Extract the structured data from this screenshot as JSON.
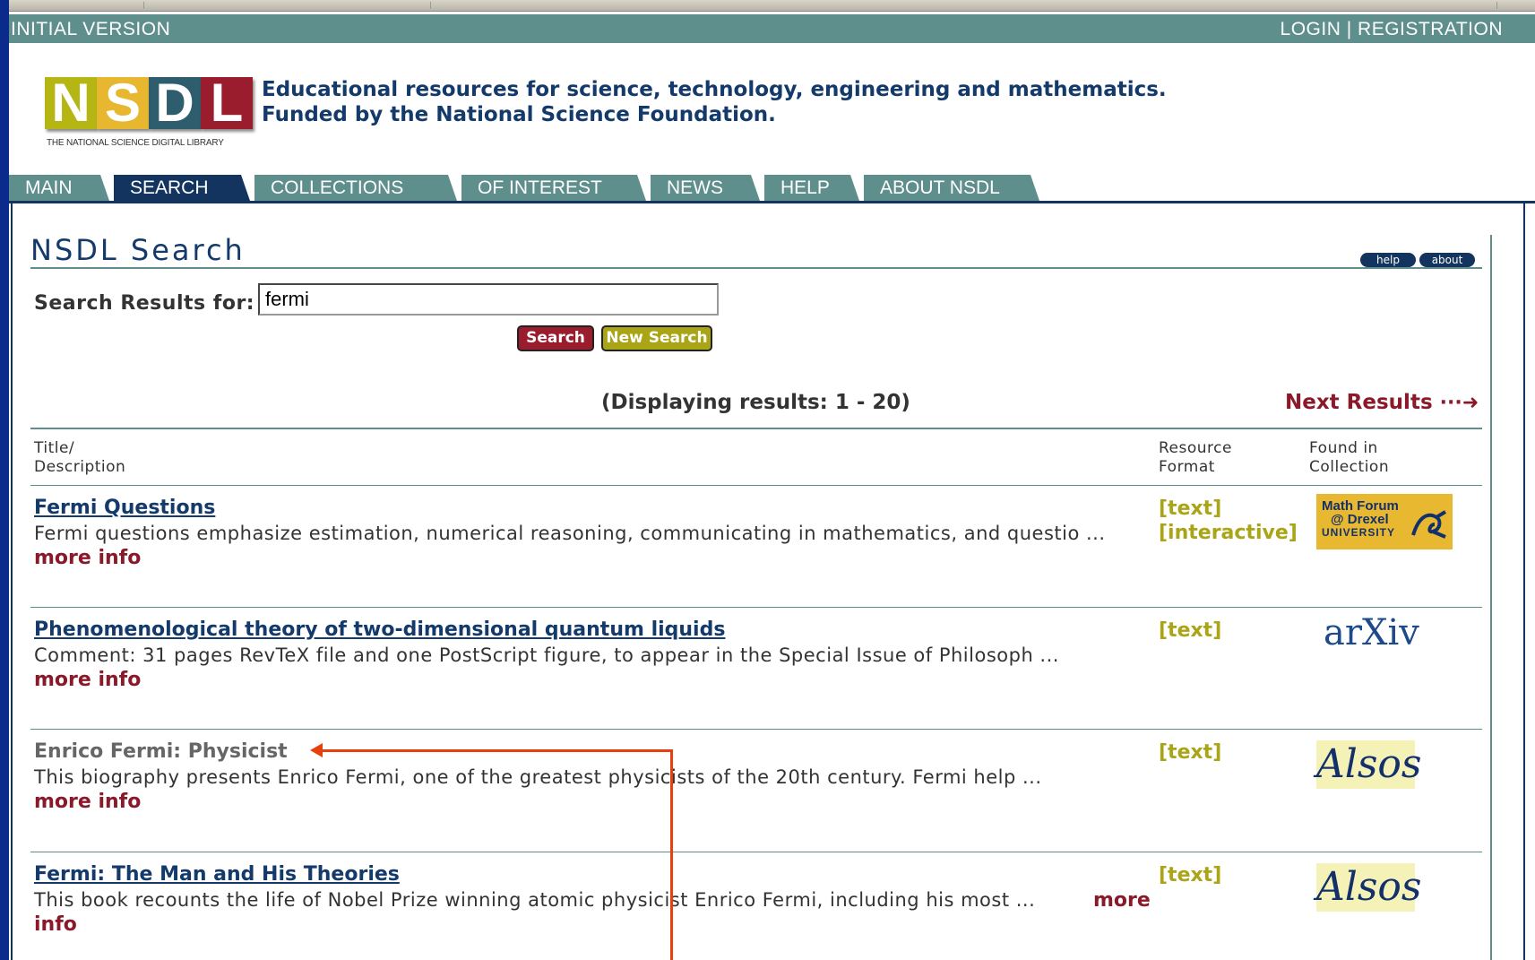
{
  "topbar": {
    "version": "INITIAL VERSION",
    "login": "LOGIN",
    "separator": "|",
    "registration": "REGISTRATION"
  },
  "logo": {
    "letters": [
      "N",
      "S",
      "D",
      "L"
    ],
    "caption": "THE NATIONAL SCIENCE DIGITAL LIBRARY"
  },
  "tagline": {
    "line1": "Educational resources for science, technology, engineering and mathematics.",
    "line2": "Funded by the National Science Foundation."
  },
  "tabs": [
    "MAIN",
    "SEARCH",
    "COLLECTIONS",
    "OF INTEREST",
    "NEWS",
    "HELP",
    "ABOUT NSDL"
  ],
  "active_tab": "SEARCH",
  "page": {
    "title": "NSDL Search",
    "help_label": "help",
    "about_label": "about"
  },
  "search": {
    "label": "Search Results for:",
    "value": "fermi",
    "search_button": "Search",
    "new_search_button": "New Search"
  },
  "results": {
    "displaying": "(Displaying results: 1 - 20)",
    "next": "Next Results",
    "next_arrow": "···➜",
    "headers": {
      "title_1": "Title/",
      "title_2": "Description",
      "format_1": "Resource",
      "format_2": "Format",
      "collection_1": "Found in",
      "collection_2": "Collection"
    },
    "items": [
      {
        "title": "Fermi Questions",
        "description": "Fermi questions emphasize estimation, numerical reasoning, communicating in mathematics, and questio ...",
        "more": "more info",
        "formats": [
          "[text]",
          "[interactive]"
        ],
        "collection": "Math Forum @ Drexel UNIVERSITY",
        "collection_l1": "Math Forum",
        "collection_l2": "@ Drexel",
        "collection_l3": "UNIVERSITY"
      },
      {
        "title": "Phenomenological theory of two-dimensional quantum liquids",
        "description": "Comment: 31 pages RevTeX file and one PostScript figure, to appear in the Special Issue of Philosoph ...",
        "more": "more info",
        "formats": [
          "[text]"
        ],
        "collection": "arXiv"
      },
      {
        "title": "Enrico Fermi: Physicist",
        "description": "This biography presents Enrico Fermi, one of the greatest physicists of the 20th century. Fermi help ...",
        "more": "more info",
        "formats": [
          "[text]"
        ],
        "collection": "Alsos"
      },
      {
        "title": "Fermi: The Man and His Theories",
        "description": "This book recounts the life of Nobel Prize winning atomic physicist Enrico Fermi, including his most ...",
        "more_1": "more",
        "more_2": "info",
        "formats": [
          "[text]"
        ],
        "collection": "Alsos"
      }
    ]
  },
  "colors": {
    "teal": "#5f8f8d",
    "navy": "#12345e",
    "maroon": "#9a1d2e",
    "olive": "#a9a516",
    "annotation": "#e8400c",
    "slide_background": "#0a2a8c"
  }
}
